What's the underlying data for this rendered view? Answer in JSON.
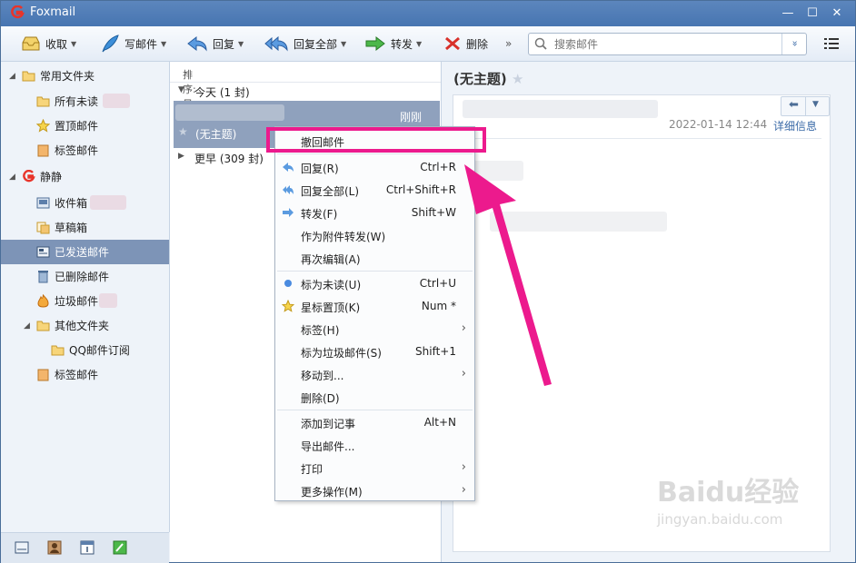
{
  "window": {
    "app_title": "Foxmail",
    "min": "—",
    "max": "☐",
    "close": "✕"
  },
  "toolbar": {
    "receive": "收取",
    "compose": "写邮件",
    "reply": "回复",
    "reply_all": "回复全部",
    "forward": "转发",
    "delete": "删除",
    "more": "»",
    "search_placeholder": "搜索邮件",
    "search_dropdown": "»"
  },
  "sidebar": {
    "common_folder": "常用文件夹",
    "all_unread": "所有未读",
    "pinned": "置顶邮件",
    "tagged": "标签邮件",
    "account": "静静",
    "inbox": "收件箱",
    "drafts": "草稿箱",
    "sent": "已发送邮件",
    "deleted": "已删除邮件",
    "junk": "垃圾邮件",
    "other_folders": "其他文件夹",
    "qq_subscription": "QQ邮件订阅",
    "tagged2": "标签邮件"
  },
  "list": {
    "sort_label": "排序:日期",
    "group_today": "今天 (1 封)",
    "group_earlier": "更早 (309 封)",
    "mail_time": "刚刚",
    "mail_subject": "(无主题)"
  },
  "reader": {
    "subject": "(无主题)",
    "datetime": "2022-01-14 12:44",
    "detail_link": "详细信息"
  },
  "context_menu": {
    "recall": "撤回邮件",
    "items": [
      {
        "label": "回复(R)",
        "shortcut": "Ctrl+R"
      },
      {
        "label": "回复全部(L)",
        "shortcut": "Ctrl+Shift+R"
      },
      {
        "label": "转发(F)",
        "shortcut": "Shift+W"
      },
      {
        "label": "作为附件转发(W)",
        "shortcut": ""
      },
      {
        "label": "再次编辑(A)",
        "shortcut": ""
      },
      {
        "label": "标为未读(U)",
        "shortcut": "Ctrl+U"
      },
      {
        "label": "星标置顶(K)",
        "shortcut": "Num *"
      },
      {
        "label": "标签(H)",
        "shortcut": ""
      },
      {
        "label": "标为垃圾邮件(S)",
        "shortcut": "Shift+1"
      },
      {
        "label": "移动到...",
        "shortcut": ""
      },
      {
        "label": "删除(D)",
        "shortcut": ""
      },
      {
        "label": "添加到记事",
        "shortcut": "Alt+N"
      },
      {
        "label": "导出邮件...",
        "shortcut": ""
      },
      {
        "label": "打印",
        "shortcut": ""
      },
      {
        "label": "更多操作(M)",
        "shortcut": ""
      }
    ],
    "submenu_glyph": "›"
  },
  "watermark": {
    "brand": "Baidu经验",
    "url": "jingyan.baidu.com"
  },
  "colors": {
    "accent": "#4775b1",
    "highlight": "#ec1a8d",
    "selection": "#7d94b7"
  }
}
